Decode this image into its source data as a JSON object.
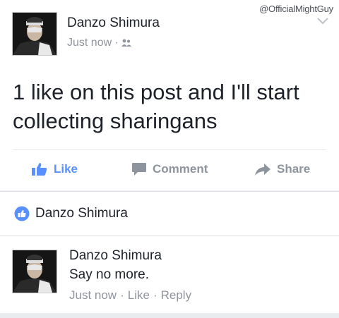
{
  "watermark": "@OfficialMightGuy",
  "post": {
    "author": "Danzo Shimura",
    "time": "Just now",
    "separator": "·",
    "privacy_icon": "friends-icon",
    "text": "1 like on this post and I'll start collecting sharingans"
  },
  "actions": {
    "like": "Like",
    "comment": "Comment",
    "share": "Share"
  },
  "reactions": {
    "name": "Danzo Shimura"
  },
  "comment": {
    "author": "Danzo Shimura",
    "text": "Say no more.",
    "time": "Just now",
    "dot1": "·",
    "like": "Like",
    "dot2": "·",
    "reply": "Reply"
  },
  "colors": {
    "like_blue": "#5890ff",
    "muted": "#90949c",
    "text": "#1d2129"
  }
}
